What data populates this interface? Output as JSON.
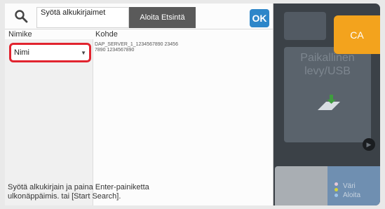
{
  "search": {
    "input_value": "Syötä alkukirjaimet",
    "start_button": "Aloita Etsintä",
    "ok_button": "OK"
  },
  "columns": {
    "title": "Nimike",
    "destination": "Kohde"
  },
  "title_select": {
    "value": "Nimi"
  },
  "destination_value": "DAP_SERVER_1_1234567890 234567890 1234567890",
  "hint": "Syötä alkukirjain ja paina Enter-painiketta ulkonäppäimis. tai [Start Search].",
  "background": {
    "ca_button": "CA",
    "local_drive": "Paikallinen levy/USB",
    "card_color": "Väri",
    "card_start": "Aloita"
  },
  "colors": {
    "highlight": "#e1242f",
    "ok_blue": "#2d86c9",
    "ca_orange": "#f3a31d"
  }
}
